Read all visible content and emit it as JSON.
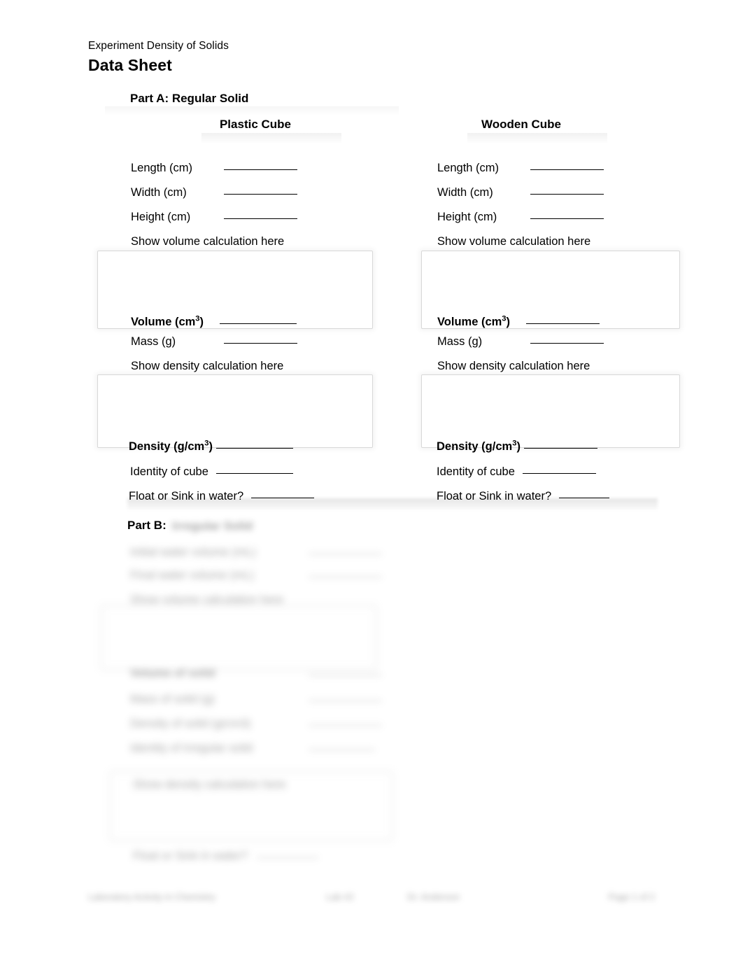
{
  "document": {
    "experiment_title": "Experiment Density of Solids",
    "sheet_title": "Data Sheet"
  },
  "part_a": {
    "heading": "Part A: Regular Solid",
    "columns": [
      {
        "title": "Plastic Cube",
        "rows": [
          {
            "label": "Length (cm)",
            "value": ""
          },
          {
            "label": "Width (cm)",
            "value": ""
          },
          {
            "label": "Height (cm)",
            "value": ""
          }
        ],
        "volume_prompt": "Show volume calculation here",
        "volume_label": "Volume (cm",
        "volume_sup": "3",
        "volume_label_end": ")",
        "mass_label": "Mass (g)",
        "density_prompt": "Show density calculation here",
        "density_label": "Density (g/cm",
        "density_sup": "3",
        "density_label_end": ")",
        "identity_label": "Identity of cube",
        "float_sink_label": "Float or Sink in water?"
      },
      {
        "title": "Wooden Cube",
        "rows": [
          {
            "label": "Length (cm)",
            "value": ""
          },
          {
            "label": "Width (cm)",
            "value": ""
          },
          {
            "label": "Height (cm)",
            "value": ""
          }
        ],
        "volume_prompt": "Show volume calculation here",
        "volume_label": "Volume (cm",
        "volume_sup": "3",
        "volume_label_end": ")",
        "mass_label": "Mass (g)",
        "density_prompt": "Show density calculation here",
        "density_label": "Density (g/cm",
        "density_sup": "3",
        "density_label_end": ")",
        "identity_label": "Identity of cube",
        "float_sink_label": "Float or Sink in water?"
      }
    ]
  },
  "part_b": {
    "heading": "Part B:",
    "subheading_redacted": "Irregular Solid",
    "lines": [
      {
        "label": "Initial water volume (mL)"
      },
      {
        "label": "Final water volume (mL)"
      },
      {
        "label": "Show volume calculation here"
      },
      {
        "label": "Volume of solid"
      },
      {
        "label": "Mass of solid (g)"
      },
      {
        "label": "Density of solid (g/cm3)"
      },
      {
        "label": "Identity of irregular solid"
      },
      {
        "label": "Show density calculation here"
      },
      {
        "label": "Float or Sink in water?"
      }
    ]
  },
  "footer": {
    "left": "Laboratory Activity in Chemistry",
    "mid1": "Lab #2",
    "mid2": "Dr. Anderson",
    "right": "Page 1 of 2"
  }
}
